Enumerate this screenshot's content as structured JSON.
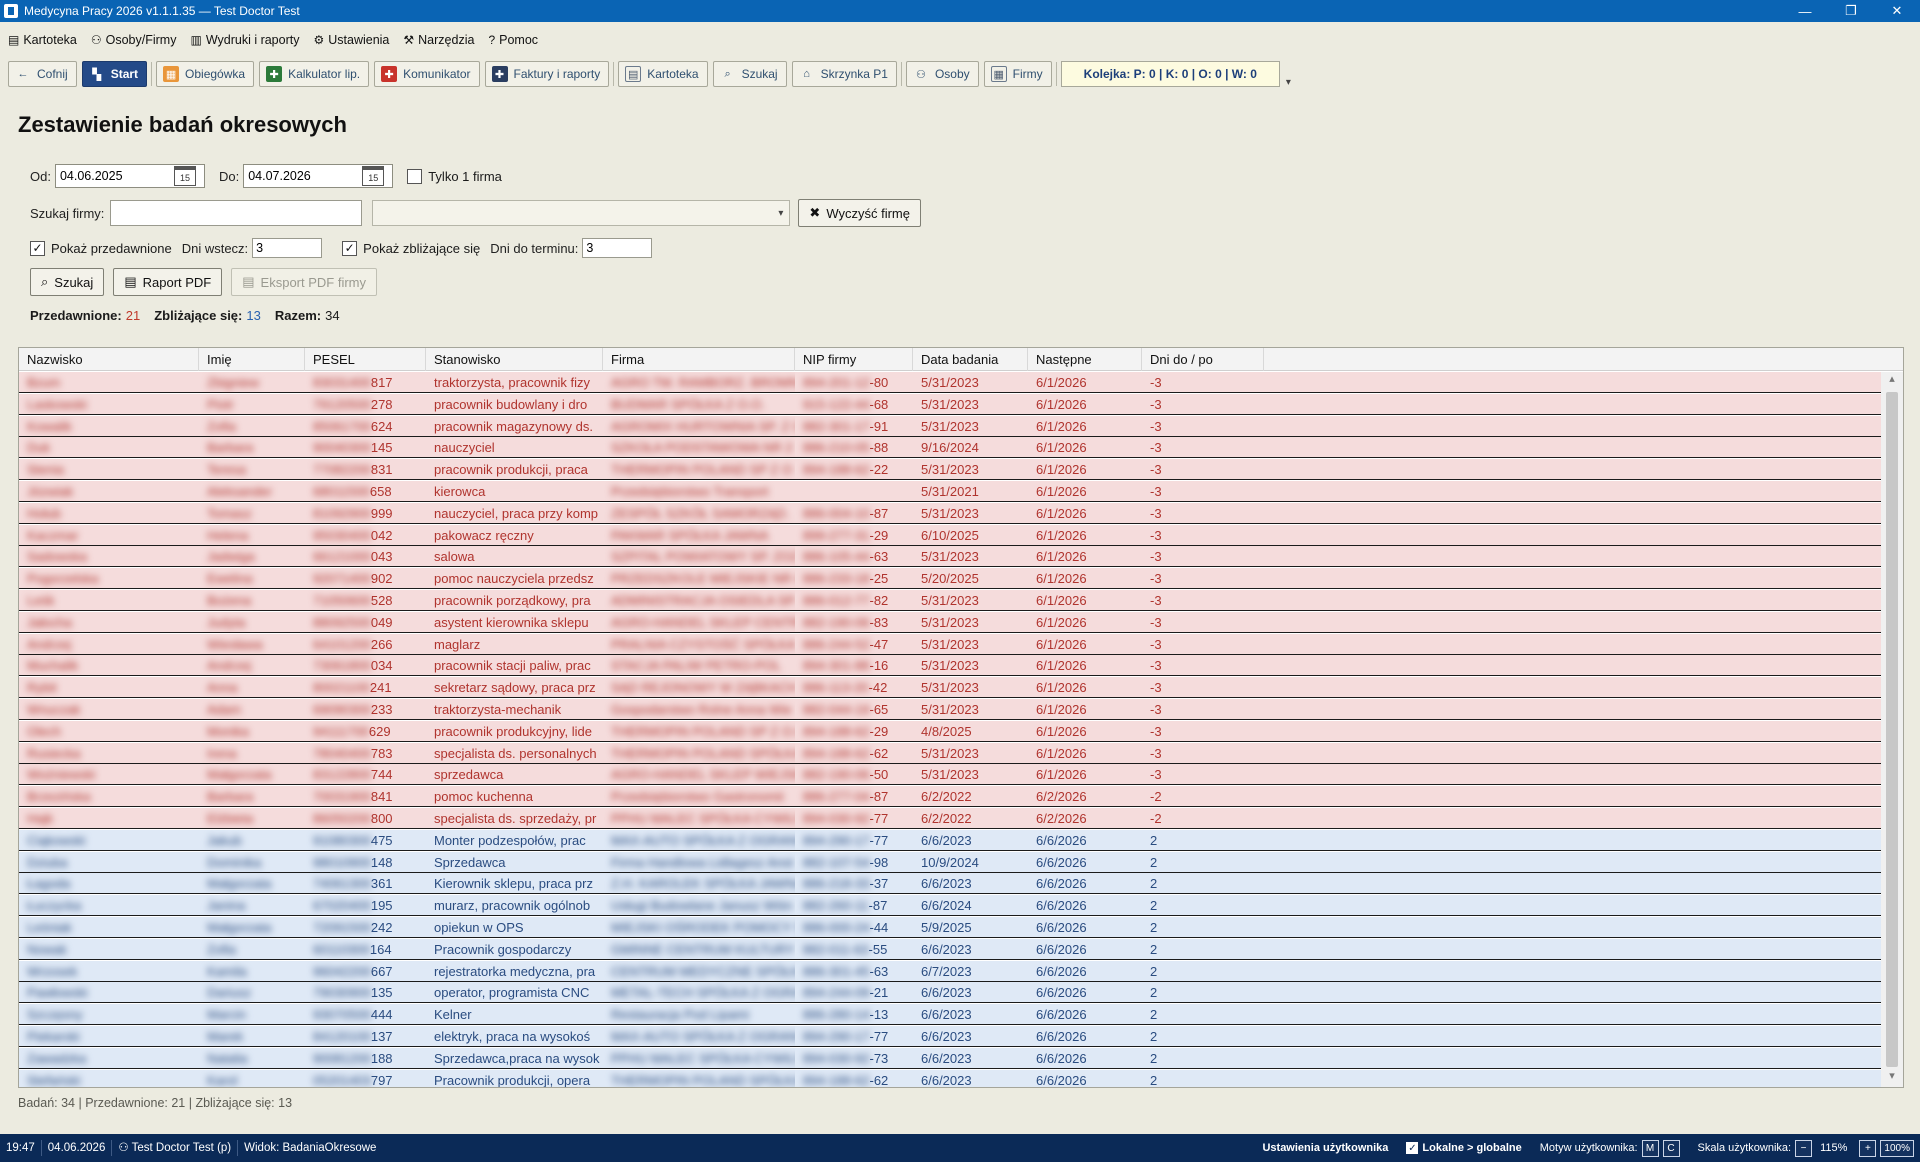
{
  "window": {
    "title": "Medycyna Pracy 2026 v1.1.1.35 — Test Doctor Test"
  },
  "menu": [
    {
      "icon": "card-icon",
      "glyph": "▤",
      "label": "Kartoteka"
    },
    {
      "icon": "people-icon",
      "glyph": "⚇",
      "label": "Osoby/Firmy"
    },
    {
      "icon": "print-icon",
      "glyph": "▥",
      "label": "Wydruki i raporty"
    },
    {
      "icon": "gear-icon",
      "glyph": "⚙",
      "label": "Ustawienia"
    },
    {
      "icon": "tools-icon",
      "glyph": "⚒",
      "label": "Narzędzia"
    },
    {
      "icon": "help-icon",
      "glyph": "?",
      "label": "Pomoc"
    }
  ],
  "toolbar": {
    "back": "Cofnij",
    "start": "Start",
    "obiegowka": "Obiegówka",
    "kalkulator": "Kalkulator lip.",
    "komunikator": "Komunikator",
    "faktury": "Faktury i raporty",
    "kartoteka": "Kartoteka",
    "szukaj": "Szukaj",
    "skrzynka": "Skrzynka P1",
    "osoby": "Osoby",
    "firmy": "Firmy",
    "queue": "Kolejka: P: 0 | K: 0 | O: 0 | W: 0"
  },
  "page": {
    "title": "Zestawienie badań okresowych"
  },
  "filters": {
    "od_label": "Od:",
    "od_value": "04.06.2025",
    "do_label": "Do:",
    "do_value": "04.07.2026",
    "cal_day": "15",
    "tylko_firma_label": "Tylko 1 firma",
    "szukaj_firmy_label": "Szukaj firmy:",
    "szukaj_firmy_value": "",
    "wyczysc_label": "Wyczyść firmę",
    "pokaz_przedawnione_label": "Pokaż przedawnione",
    "dni_wstecz_label": "Dni wstecz:",
    "dni_wstecz_value": "3",
    "pokaz_zblizajace_label": "Pokaż zbliżające się",
    "dni_do_terminu_label": "Dni do terminu:",
    "dni_do_terminu_value": "3",
    "szukaj_button": "Szukaj",
    "raport_button": "Raport PDF",
    "eksport_button": "Eksport PDF firmy"
  },
  "summary": {
    "przedawnione_label": "Przedawnione:",
    "przedawnione_value": "21",
    "zblizajace_label": "Zbliżające się:",
    "zblizajace_value": "13",
    "razem_label": "Razem:",
    "razem_value": "34"
  },
  "grid": {
    "columns": [
      "Nazwisko",
      "Imię",
      "PESEL",
      "Stanowisko",
      "Firma",
      "NIP firmy",
      "Data badania",
      "Następne",
      "Dni do / po"
    ],
    "rows": [
      {
        "status": "overdue",
        "nazwisko": "Bzum",
        "imie": "Zbigniew",
        "pesel": "83031400817",
        "stanowisko": "traktorzysta, pracownik fizy",
        "firma": "AGRO TM. RAMBORZ. BROMNI",
        "nip": "894-201-12-80",
        "data": "5/31/2023",
        "nastepne": "6/1/2026",
        "dni": "-3"
      },
      {
        "status": "overdue",
        "nazwisko": "Laskowski",
        "imie": "Piotr",
        "pesel": "79120500278",
        "stanowisko": "pracownik budowlany i dro",
        "firma": "BUDMAR SPÓŁKA Z O.O.",
        "nip": "915-122-44-68",
        "data": "5/31/2023",
        "nastepne": "6/1/2026",
        "dni": "-3"
      },
      {
        "status": "overdue",
        "nazwisko": "Kowalik",
        "imie": "Zofia",
        "pesel": "85061700624",
        "stanowisko": "pracownik magazynowy ds.",
        "firma": "AGROMIX HURTOWNIA SP. Z O",
        "nip": "882-301-17-91",
        "data": "5/31/2023",
        "nastepne": "6/1/2026",
        "dni": "-3"
      },
      {
        "status": "overdue",
        "nazwisko": "Duk",
        "imie": "Barbara",
        "pesel": "90040300145",
        "stanowisko": "nauczyciel",
        "firma": "SZKOŁA PODSTAWOWA NR 2",
        "nip": "886-210-05-88",
        "data": "9/16/2024",
        "nastepne": "6/1/2026",
        "dni": "-3"
      },
      {
        "status": "overdue",
        "nazwisko": "Stenia",
        "imie": "Teresa",
        "pesel": "77082200831",
        "stanowisko": "pracownik produkcji, praca",
        "firma": "THERMOPIN POLAND SP Z O",
        "nip": "894-188-62-22",
        "data": "5/31/2023",
        "nastepne": "6/1/2026",
        "dni": "-3"
      },
      {
        "status": "overdue",
        "nazwisko": "Józwiak",
        "imie": "Aleksander",
        "pesel": "68011500658",
        "stanowisko": "kierowca",
        "firma": "Przedsiębiorstwo Transport",
        "nip": "",
        "data": "5/31/2021",
        "nastepne": "6/1/2026",
        "dni": "-3"
      },
      {
        "status": "overdue",
        "nazwisko": "Hołub",
        "imie": "Tomasz",
        "pesel": "81092900999",
        "stanowisko": "nauczyciel, praca przy komp",
        "firma": "ZESPÓŁ SZKÓŁ SAMORZĄD.",
        "nip": "886-004-10-87",
        "data": "5/31/2023",
        "nastepne": "6/1/2026",
        "dni": "-3"
      },
      {
        "status": "overdue",
        "nazwisko": "Kaczmar",
        "imie": "Helena",
        "pesel": "95030400042",
        "stanowisko": "pakowacz ręczny",
        "firma": "PAKMAR SPÓŁKA JAWNA",
        "nip": "899-277-31-29",
        "data": "6/10/2025",
        "nastepne": "6/1/2026",
        "dni": "-3"
      },
      {
        "status": "overdue",
        "nazwisko": "Sadowska",
        "imie": "Jadwiga",
        "pesel": "66121000043",
        "stanowisko": "salowa",
        "firma": "SZPITAL POWIATOWY SP. ZOZ",
        "nip": "886-105-44-63",
        "data": "5/31/2023",
        "nastepne": "6/1/2026",
        "dni": "-3"
      },
      {
        "status": "overdue",
        "nazwisko": "Pogorzelska",
        "imie": "Ewelina",
        "pesel": "92071400902",
        "stanowisko": "pomoc nauczyciela przedsz",
        "firma": "PRZEDSZKOLE MIEJSKIE NR 4",
        "nip": "886-233-18-25",
        "data": "5/20/2025",
        "nastepne": "6/1/2026",
        "dni": "-3"
      },
      {
        "status": "overdue",
        "nazwisko": "Leśk",
        "imie": "Bożena",
        "pesel": "71050600528",
        "stanowisko": "pracownik porządkowy, pra",
        "firma": "ADMINISTRACJA OSIEDLA SP.",
        "nip": "886-012-77-82",
        "data": "5/31/2023",
        "nastepne": "6/1/2026",
        "dni": "-3"
      },
      {
        "status": "overdue",
        "nazwisko": "Jałocha",
        "imie": "Judyta",
        "pesel": "88092500049",
        "stanowisko": "asystent kierownika sklepu",
        "firma": "AGRO-HANDEL SKLEP CENTRUM",
        "nip": "882-190-06-83",
        "data": "5/31/2023",
        "nastepne": "6/1/2026",
        "dni": "-3"
      },
      {
        "status": "overdue",
        "nazwisko": "Andrzej",
        "imie": "Wiesława",
        "pesel": "64101200266",
        "stanowisko": "maglarz",
        "firma": "PRALNIA CZYSTOŚĆ SPÓŁKA",
        "nip": "886-244-52-47",
        "data": "5/31/2023",
        "nastepne": "6/1/2026",
        "dni": "-3"
      },
      {
        "status": "overdue",
        "nazwisko": "Muchalik",
        "imie": "Andrzej",
        "pesel": "73061800034",
        "stanowisko": "pracownik stacji paliw, prac",
        "firma": "STACJA PALIW PETRO-POL",
        "nip": "894-301-88-16",
        "data": "5/31/2023",
        "nastepne": "6/1/2026",
        "dni": "-3"
      },
      {
        "status": "overdue",
        "nazwisko": "Rybit",
        "imie": "Anna",
        "pesel": "80021100241",
        "stanowisko": "sekretarz sądowy, praca prz",
        "firma": "SĄD REJONOWY W ZĄBKACH",
        "nip": "886-113-20-42",
        "data": "5/31/2023",
        "nastepne": "6/1/2026",
        "dni": "-3"
      },
      {
        "status": "overdue",
        "nazwisko": "Wnuczak",
        "imie": "Adam",
        "pesel": "69090300233",
        "stanowisko": "traktorzysta-mechanik",
        "firma": "Gospodarstwo Rolne Anna Wie",
        "nip": "882-044-19-65",
        "data": "5/31/2023",
        "nastepne": "6/1/2026",
        "dni": "-3"
      },
      {
        "status": "overdue",
        "nazwisko": "Olech",
        "imie": "Monika",
        "pesel": "94111700629",
        "stanowisko": "pracownik produkcyjny, lide",
        "firma": "THERMOPIN POLAND SP Z O.O",
        "nip": "894-188-62-29",
        "data": "4/8/2025",
        "nastepne": "6/1/2026",
        "dni": "-3"
      },
      {
        "status": "overdue",
        "nazwisko": "Rusiecka",
        "imie": "Irena",
        "pesel": "78040400783",
        "stanowisko": "specjalista ds. personalnych",
        "firma": "THERMOPIN POLAND SPÓŁKA Z",
        "nip": "894-188-62-62",
        "data": "5/31/2023",
        "nastepne": "6/1/2026",
        "dni": "-3"
      },
      {
        "status": "overdue",
        "nazwisko": "Woźniewski",
        "imie": "Małgorzata",
        "pesel": "83122800744",
        "stanowisko": "sprzedawca",
        "firma": "AGRO-HANDEL SKLEP WIEJSKI",
        "nip": "882-190-06-50",
        "data": "5/31/2023",
        "nastepne": "6/1/2026",
        "dni": "-3"
      },
      {
        "status": "overdue",
        "nazwisko": "Brzezińska",
        "imie": "Barbara",
        "pesel": "70031900841",
        "stanowisko": "pomoc kuchenna",
        "firma": "Przedsiębiorstwo Gastronomii",
        "nip": "886-277-04-87",
        "data": "6/2/2022",
        "nastepne": "6/2/2026",
        "dni": "-2"
      },
      {
        "status": "overdue",
        "nazwisko": "Hajk",
        "imie": "Elżbieta",
        "pesel": "86050200800",
        "stanowisko": "specjalista ds. sprzedaży, pr",
        "firma": "PPHU MALEC SPÓŁKA CYWILNA",
        "nip": "894-030-92-77",
        "data": "6/2/2022",
        "nastepne": "6/2/2026",
        "dni": "-2"
      },
      {
        "status": "upcoming",
        "nazwisko": "Ciąkowski",
        "imie": "Jakub",
        "pesel": "91080300475",
        "stanowisko": "Monter podzespołów, prac",
        "firma": "MAX-AUTO SPÓŁKA Z OGRANICZ",
        "nip": "894-290-17-77",
        "data": "6/6/2023",
        "nastepne": "6/6/2026",
        "dni": "2"
      },
      {
        "status": "upcoming",
        "nazwisko": "Dziuba",
        "imie": "Dominika",
        "pesel": "98010900148",
        "stanowisko": "Sprzedawca",
        "firma": "Firma Handlowa Lidlagesz Anst",
        "nip": "882-107-54-98",
        "data": "10/9/2024",
        "nastepne": "6/6/2026",
        "dni": "2"
      },
      {
        "status": "upcoming",
        "nazwisko": "Łagoda",
        "imie": "Małgorzata",
        "pesel": "74061300361",
        "stanowisko": "Kierownik sklepu, praca prz",
        "firma": "Z.H. KAROLEK SPÓŁKA JAWNA",
        "nip": "886-218-33-37",
        "data": "6/6/2023",
        "nastepne": "6/6/2026",
        "dni": "2"
      },
      {
        "status": "upcoming",
        "nazwisko": "Łuczycka",
        "imie": "Janina",
        "pesel": "67020400195",
        "stanowisko": "murarz, pracownik ogólnob",
        "firma": "Usługi Budowlane Janusz Wiśn",
        "nip": "882-260-11-87",
        "data": "6/6/2024",
        "nastepne": "6/6/2026",
        "dni": "2"
      },
      {
        "status": "upcoming",
        "nazwisko": "Leśniak",
        "imie": "Małgorzata",
        "pesel": "72091500242",
        "stanowisko": "opiekun w OPS",
        "firma": "MIEJSKI OŚRODEK POMOCY SPOŁ",
        "nip": "886-000-24-44",
        "data": "5/9/2025",
        "nastepne": "6/6/2026",
        "dni": "2"
      },
      {
        "status": "upcoming",
        "nazwisko": "Nowak",
        "imie": "Zofia",
        "pesel": "60110300164",
        "stanowisko": "Pracownik gospodarczy",
        "firma": "GMINNE CENTRUM KULTURY",
        "nip": "882-011-63-55",
        "data": "6/6/2023",
        "nastepne": "6/6/2026",
        "dni": "2"
      },
      {
        "status": "upcoming",
        "nazwisko": "Wrzosek",
        "imie": "Kamila",
        "pesel": "96042200667",
        "stanowisko": "rejestratorka medyczna, pra",
        "firma": "CENTRUM MEDYCZNE SPÓŁKA",
        "nip": "886-301-45-63",
        "data": "6/7/2023",
        "nastepne": "6/6/2026",
        "dni": "2"
      },
      {
        "status": "upcoming",
        "nazwisko": "Pawłowski",
        "imie": "Dariusz",
        "pesel": "79030900135",
        "stanowisko": "operator, programista CNC",
        "firma": "METAL-TECH SPÓŁKA Z OGRAN",
        "nip": "894-244-09-21",
        "data": "6/6/2023",
        "nastepne": "6/6/2026",
        "dni": "2"
      },
      {
        "status": "upcoming",
        "nazwisko": "Szczęsny",
        "imie": "Marcin",
        "pesel": "93070500444",
        "stanowisko": "Kelner",
        "firma": "Restauracja Pod Lipami",
        "nip": "886-280-14-13",
        "data": "6/6/2023",
        "nastepne": "6/6/2026",
        "dni": "2"
      },
      {
        "status": "upcoming",
        "nazwisko": "Piekarski",
        "imie": "Marek",
        "pesel": "84120100137",
        "stanowisko": "elektryk, praca na wysokoś",
        "firma": "MAX-AUTO SPÓŁKA Z OGRANICZ",
        "nip": "894-290-17-77",
        "data": "6/6/2023",
        "nastepne": "6/6/2026",
        "dni": "2"
      },
      {
        "status": "upcoming",
        "nazwisko": "Zawadzka",
        "imie": "Natalia",
        "pesel": "90081200188",
        "stanowisko": "Sprzedawca,praca na wysok",
        "firma": "PPHU MALEC SPÓŁKA CYWILNA",
        "nip": "894-030-92-73",
        "data": "6/6/2023",
        "nastepne": "6/6/2026",
        "dni": "2"
      },
      {
        "status": "upcoming",
        "nazwisko": "Stefański",
        "imie": "Karol",
        "pesel": "05201403797",
        "stanowisko": "Pracownik produkcji, opera",
        "firma": "THERMOPIN POLAND SPÓŁKA Z",
        "nip": "894-188-62-62",
        "data": "6/6/2023",
        "nastepne": "6/6/2026",
        "dni": "2"
      }
    ]
  },
  "footer_note": "Badań: 34 | Przedawnione: 21 | Zbliżające się: 13",
  "statusbar": {
    "time": "19:47",
    "date": "04.06.2026",
    "user": "Test Doctor Test (p)",
    "view": "Widok: BadaniaOkresowe",
    "user_settings": "Ustawienia użytkownika",
    "local_global": "Lokalne > globalne",
    "theme_label": "Motyw użytkownika:",
    "theme_m": "M",
    "theme_c": "C",
    "scale_label": "Skala użytkownika:",
    "scale_minus": "−",
    "scale_value": "115%",
    "scale_plus": "+",
    "scale_reset": "100%"
  },
  "colors": {
    "titlebar": "#0a64b4",
    "overdue_row": "#f5dcdc",
    "overdue_text": "#b0342e",
    "upcoming_row": "#dfe9f6",
    "upcoming_text": "#2a4c80",
    "statusbar": "#0b2a57"
  }
}
